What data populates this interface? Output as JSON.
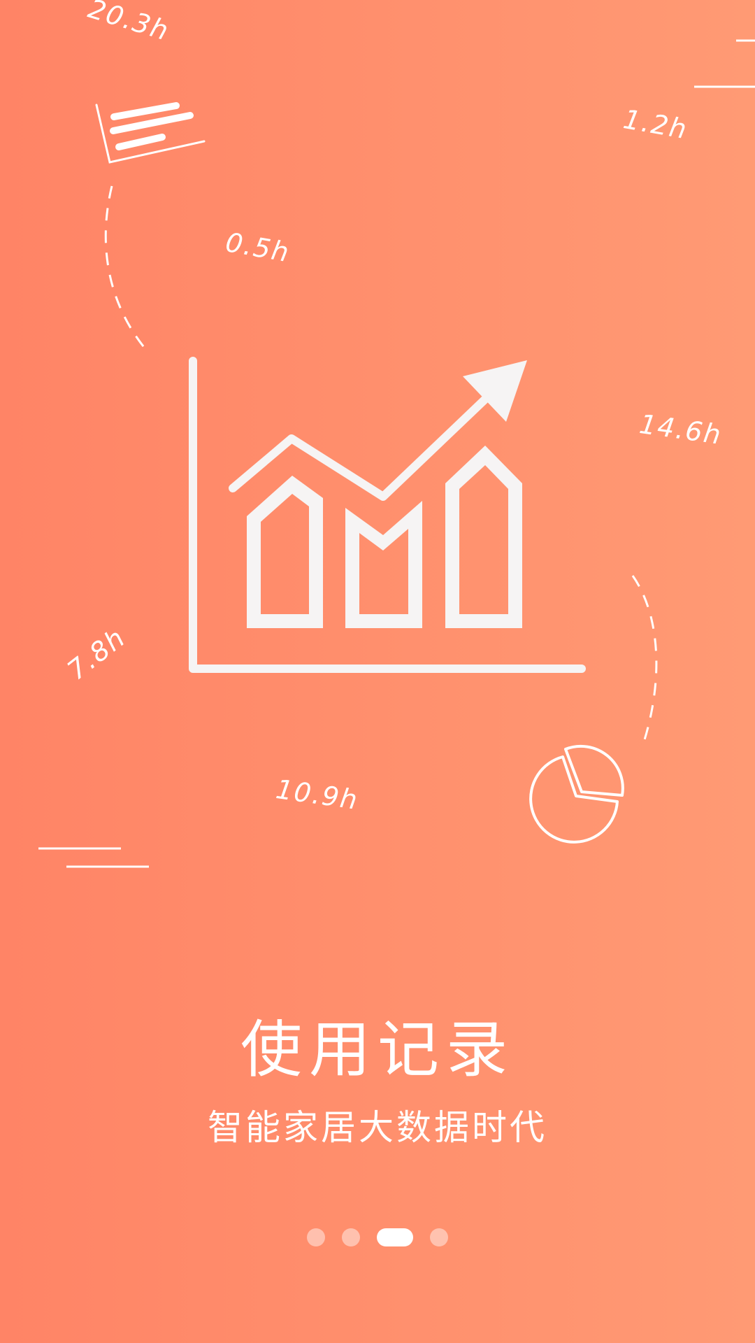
{
  "onboarding": {
    "title": "使用记录",
    "subtitle": "智能家居大数据时代",
    "hour_labels": [
      "20.3h",
      "1.2h",
      "0.5h",
      "14.6h",
      "7.8h",
      "10.9h"
    ]
  },
  "pagination": {
    "total": 4,
    "active_index": 2
  },
  "illustrations": {
    "main": "growth-chart-icon",
    "document": "document-icon",
    "pie": "pie-chart-icon"
  },
  "colors": {
    "gradient_left": "#ff8466",
    "gradient_right": "#ff9a74",
    "foreground": "#ffffff"
  }
}
